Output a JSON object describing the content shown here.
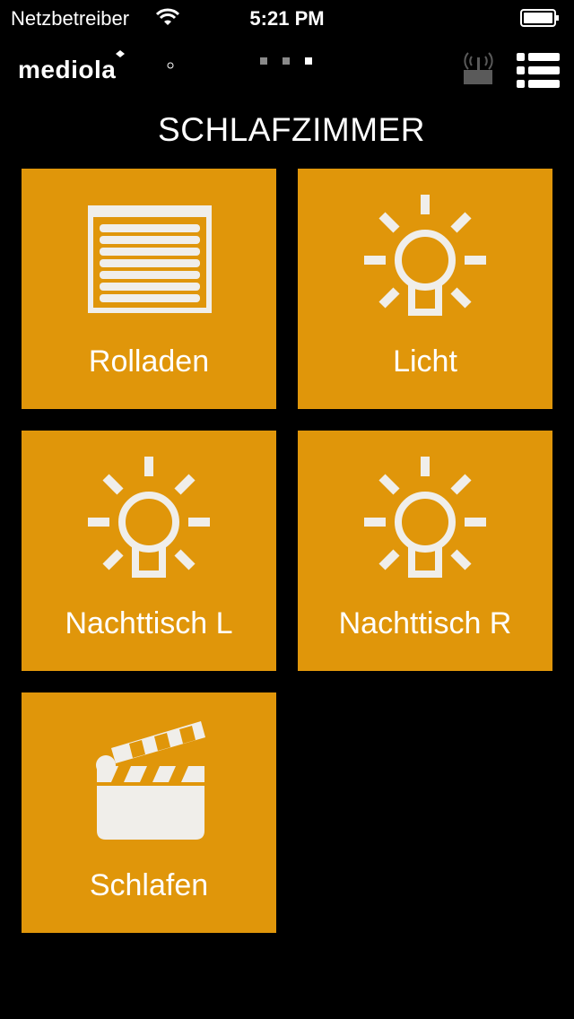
{
  "status_bar": {
    "carrier": "Netzbetreiber",
    "time": "5:21 PM"
  },
  "header": {
    "logo_text": "mediola",
    "page_indicator": {
      "count": 3,
      "active_index": 2
    },
    "gateway_icon": "gateway-antenna-icon",
    "menu_icon": "list-menu-icon"
  },
  "room": {
    "title": "SCHLAFZIMMER"
  },
  "colors": {
    "background": "#000000",
    "tile": "#e0960a",
    "icon": "#f0eeea",
    "text": "#ffffff"
  },
  "tiles": [
    {
      "label": "Rolladen",
      "icon": "roller-shutter-icon"
    },
    {
      "label": "Licht",
      "icon": "light-bulb-icon"
    },
    {
      "label": "Nachttisch L",
      "icon": "light-bulb-icon"
    },
    {
      "label": "Nachttisch R",
      "icon": "light-bulb-icon"
    },
    {
      "label": "Schlafen",
      "icon": "clapperboard-icon"
    }
  ]
}
